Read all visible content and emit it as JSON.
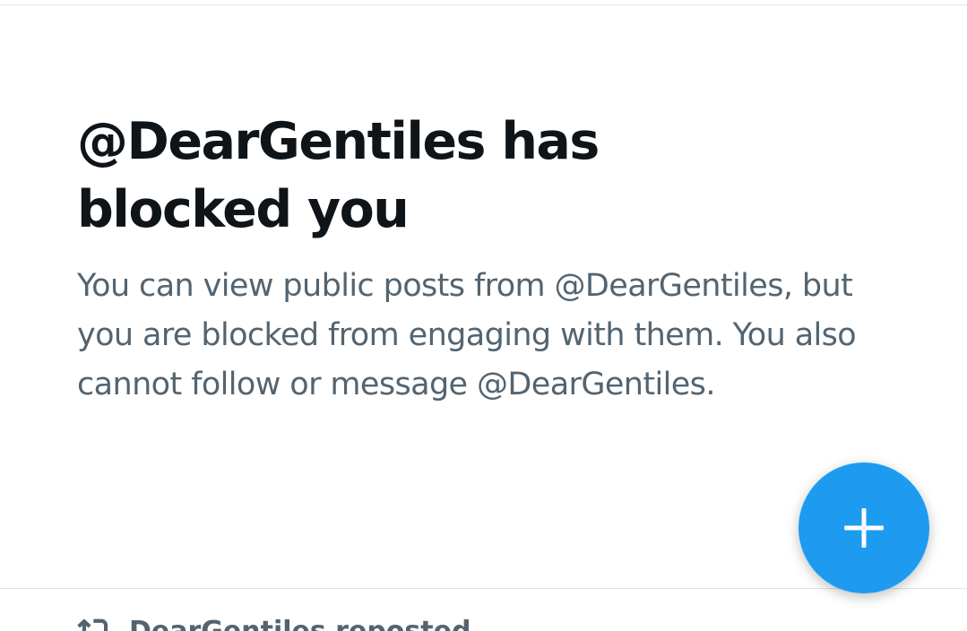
{
  "blocked_notice": {
    "title": "@DearGentiles has blocked you",
    "description": "You can view public posts from @DearGentiles, but you are blocked from engaging with them. You also cannot follow or message @DearGentiles."
  },
  "compose_button": {
    "icon": "plus-icon",
    "color": "#1d9bf0"
  },
  "repost_row": {
    "icon": "repost-icon",
    "text": "DearGentiles reposted"
  },
  "colors": {
    "title": "#0f1419",
    "secondary_text": "#536471",
    "divider": "#dde3e7",
    "accent": "#1d9bf0"
  }
}
